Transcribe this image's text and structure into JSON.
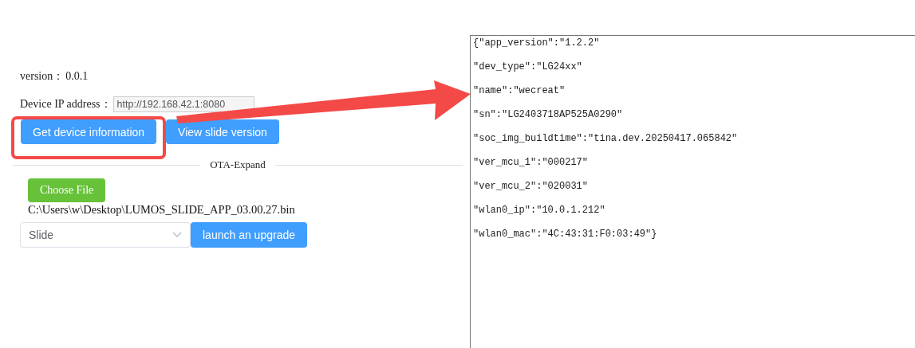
{
  "version": {
    "label": "version：",
    "value": "0.0.1"
  },
  "device_ip": {
    "label": "Device IP address：",
    "value": "http://192.168.42.1:8080"
  },
  "buttons": [
    {
      "label": "Get device information",
      "highlighted": true
    },
    {
      "label": "View slide version",
      "highlighted": false
    }
  ],
  "divider": {
    "label": "OTA-Expand"
  },
  "file": {
    "button": "Choose File",
    "path": "C:\\Users\\w\\Desktop\\LUMOS_SLIDE_APP_03.00.27.bin"
  },
  "target_select": {
    "value": "Slide"
  },
  "upgrade_button": {
    "label": "launch an upgrade"
  },
  "output_lines": [
    "{\"app_version\":\"1.2.2\"",
    "\"dev_type\":\"LG24xx\"",
    "\"name\":\"wecreat\"",
    "\"sn\":\"LG2403718AP525A0290\"",
    "\"soc_img_buildtime\":\"tina.dev.20250417.065842\"",
    "\"ver_mcu_1\":\"000217\"",
    "\"ver_mcu_2\":\"020031\"",
    "\"wlan0_ip\":\"10.0.1.212\"",
    "\"wlan0_mac\":\"4C:43:31:F0:03:49\"}"
  ]
}
